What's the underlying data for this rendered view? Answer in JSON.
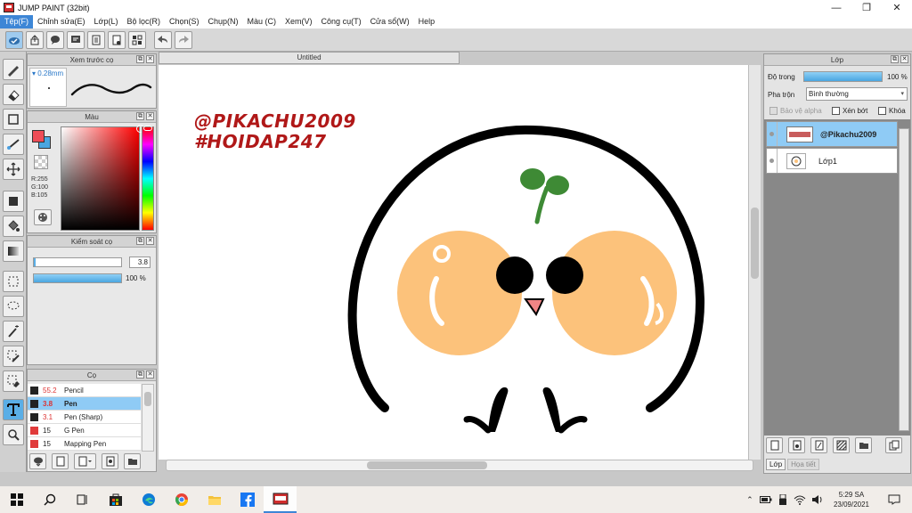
{
  "window": {
    "title": "JUMP PAINT (32bit)"
  },
  "menu": [
    "Tệp(F)",
    "Chỉnh sửa(E)",
    "Lớp(L)",
    "Bộ lọc(R)",
    "Chọn(S)",
    "Chụp(N)",
    "Màu (C)",
    "Xem(V)",
    "Công cụ(T)",
    "Cửa sổ(W)",
    "Help"
  ],
  "document": {
    "tab_label": "Untitled"
  },
  "brush_preview": {
    "title": "Xem trước cọ",
    "size": "▾ 0.28mm"
  },
  "color_panel": {
    "title": "Màu",
    "r": "R:255",
    "g": "G:100",
    "b": "B:105",
    "fg": "#ee4d57",
    "bg": "#4aa6e0"
  },
  "control_panel": {
    "title": "Kiểm soát cọ",
    "size_value": "3.8",
    "opacity_value": "100 %",
    "opacity_percent": 100
  },
  "brush_panel": {
    "title": "Cọ",
    "items": [
      {
        "size": "55.2",
        "name": "Pencil"
      },
      {
        "size": "3.8",
        "name": "Pen"
      },
      {
        "size": "3.1",
        "name": "Pen (Sharp)"
      },
      {
        "size": "15",
        "name": "G Pen"
      },
      {
        "size": "15",
        "name": "Mapping Pen"
      }
    ]
  },
  "canvas": {
    "watermark_line1": "@PIKACHU2009",
    "watermark_line2": "#HOIDAP247"
  },
  "layer_panel": {
    "title": "Lớp",
    "opacity_label": "Độ trong",
    "opacity_value": "100 %",
    "opacity_percent": 100,
    "blend_label": "Pha trộn",
    "blend_value": "Bình thường",
    "protect_alpha": "Bảo vệ alpha",
    "clipping": "Xén bớt",
    "lock": "Khóa",
    "layers": [
      {
        "name": "@Pikachu2009",
        "selected": true
      },
      {
        "name": "Lớp1",
        "selected": false
      }
    ],
    "tabs": [
      "Lớp",
      "Họa tiết"
    ]
  },
  "taskbar": {
    "time": "5:29 SA",
    "date": "23/09/2021"
  },
  "colors": {
    "accent": "#3d86d6",
    "selection": "#8fcbf5",
    "watermark": "#b01818",
    "blush": "#fcc27b",
    "sprout": "#3e8a35"
  }
}
